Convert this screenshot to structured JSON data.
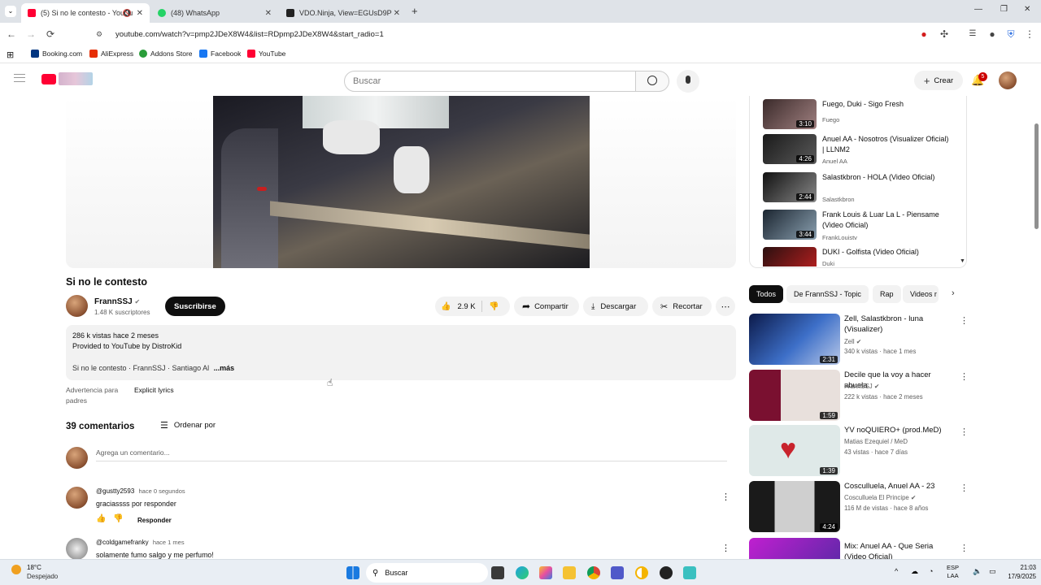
{
  "browser": {
    "tabs": [
      {
        "label": "(5) Si no le contesto - YouTu",
        "color": "#ff0033"
      },
      {
        "label": "(48) WhatsApp",
        "color": "#25d366"
      },
      {
        "label": "VDO.Ninja, View=EGUsD9P",
        "color": "#222222"
      }
    ],
    "url": "youtube.com/watch?v=pmp2JDeX8W4&list=RDpmp2JDeX8W4&start_radio=1",
    "bookmarks": [
      {
        "label": "Booking.com",
        "color": "#003580"
      },
      {
        "label": "AliExpress",
        "color": "#e62e04"
      },
      {
        "label": "Addons Store",
        "color": "#2a9d3a"
      },
      {
        "label": "Facebook",
        "color": "#1877f2"
      },
      {
        "label": "YouTube",
        "color": "#ff0033"
      }
    ]
  },
  "header": {
    "search_placeholder": "Buscar",
    "create_label": "Crear",
    "notif_count": "5"
  },
  "video": {
    "title": "Si no le contesto",
    "channel": "FrannSSJ",
    "subscribers": "1.48 K suscriptores",
    "subscribe_label": "Suscribirse",
    "likes": "2.9 K",
    "share_label": "Compartir",
    "download_label": "Descargar",
    "clip_label": "Recortar",
    "description": {
      "stats": "286 k vistas  hace 2 meses",
      "line2": "Provided to YouTube by DistroKid",
      "line3": "Si no le contesto · FrannSSJ · Santiago Al",
      "more": "...más"
    },
    "advisory_label": "Advertencia para padres",
    "advisory_value": "Explicit lyrics"
  },
  "comments": {
    "count_label": "39 comentarios",
    "sort_label": "Ordenar por",
    "add_placeholder": "Agrega un comentario...",
    "items": [
      {
        "author": "@gustty2593",
        "time": "hace 0 segundos",
        "text": "graciassss por responder",
        "reply_label": "Responder"
      },
      {
        "author": "@coldgamefranky",
        "time": "hace 1 mes",
        "text": "solamente fumo salgo y me perfumo!"
      }
    ]
  },
  "queue": [
    {
      "title": "Fuego, Duki - Sigo Fresh",
      "channel": "Fuego",
      "duration": "3:10"
    },
    {
      "title": "Anuel AA - Nosotros (Visualizer Oficial) | LLNM2",
      "channel": "Anuel AA",
      "duration": "4:26"
    },
    {
      "title": "Salastkbron - HOLA (Video Oficial)",
      "channel": "Salastkbron",
      "duration": "2:44"
    },
    {
      "title": "Frank Louis & Luar La L - Piensame (Video Oficial)",
      "channel": "FrankLouistv",
      "duration": "3:44"
    },
    {
      "title": "DUKI - Golfista (Video Oficial)",
      "channel": "Duki",
      "duration": ""
    }
  ],
  "chips": [
    "Todos",
    "De FrannSSJ - Topic",
    "Rap",
    "Videos r"
  ],
  "recommendations": [
    {
      "title": "Zell, Salastkbron - luna (Visualizer)",
      "channel": "Zell",
      "meta": "340 k vistas · hace 1 mes",
      "duration": "2:31",
      "color1": "#1b2a6b",
      "color2": "#5a8ad8"
    },
    {
      "title": "Decile que la voy a hacer abuela",
      "channel": "FrannSSJ",
      "meta": "222 k vistas · hace 2 meses",
      "duration": "1:59",
      "color1": "#7a1030",
      "color2": "#e8e0dc"
    },
    {
      "title": "YV noQUIERO+ (prod.MeD)",
      "channel": "Matias Ezequiel / MeD",
      "meta": "43 vistas · hace 7 días",
      "duration": "1:39",
      "color1": "#dfe9e8",
      "color2": "#c8232c"
    },
    {
      "title": "Cosculluela, Anuel AA - 23",
      "channel": "Cosculluela El Principe",
      "meta": "116 M de vistas · hace 8 años",
      "duration": "4:24",
      "color1": "#1a1a1a",
      "color2": "#c9c9c9"
    },
    {
      "title": "Mix: Anuel AA - Que Seria (Video Oficial)",
      "channel": "",
      "meta": "",
      "duration": "",
      "color1": "#c01fd0",
      "color2": "#4a2aa0"
    }
  ],
  "taskbar": {
    "weather_temp": "18°C",
    "weather_desc": "Despejado",
    "search_label": "Buscar",
    "lang1": "ESP",
    "lang2": "LAA",
    "time": "21:03",
    "date": "17/9/2025"
  }
}
